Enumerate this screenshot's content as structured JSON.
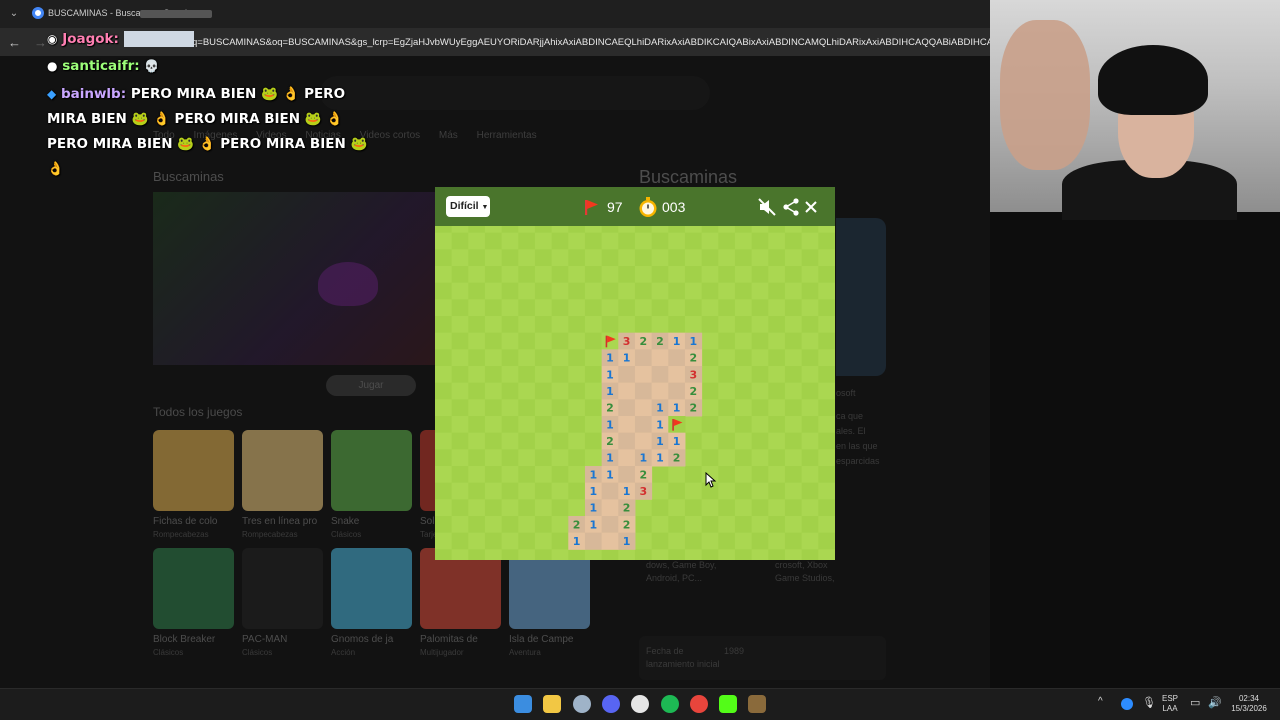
{
  "browser": {
    "tab_title": "BUSCAMINAS - Buscar con Google",
    "url": "q=BUSCAMINAS&oq=BUSCAMINAS&gs_lcrp=EgZjaHJvbWUyEggAEUYORiDARjjAhixAxiABDINCAEQLhiDARixAxiABDIKCAIQABixAxiABDINCAMQLhiDARixAxiABDIHCAQQABiABDIHCAUQABiABDIH"
  },
  "page": {
    "tabs": [
      "Todo",
      "Imágenes",
      "Videos",
      "Noticias",
      "Videos cortos",
      "Más",
      "Herramientas"
    ],
    "left_title": "Buscaminas",
    "play_label": "Jugar",
    "all_games_label": "Todos los juegos",
    "games_row1": [
      {
        "name": "Fichas de colo",
        "sub": "Rompecabezas",
        "color": "#e0b050"
      },
      {
        "name": "Tres en línea pro",
        "sub": "Rompecabezas",
        "color": "#e6c27a"
      },
      {
        "name": "Snake",
        "sub": "Clásicos",
        "color": "#5fb04a"
      },
      {
        "name": "Sol",
        "sub": "Tarje",
        "color": "#c0392b"
      }
    ],
    "games_row2": [
      {
        "name": "Block Breaker",
        "sub": "Clásicos",
        "color": "#2f7d4a"
      },
      {
        "name": "PAC-MAN",
        "sub": "Clásicos",
        "color": "#222222"
      },
      {
        "name": "Gnomos de ja",
        "sub": "Acción",
        "color": "#49b3d9"
      },
      {
        "name": "Palomitas de",
        "sub": "Multijugador",
        "color": "#d94a3a"
      },
      {
        "name": "Isla de Campe",
        "sub": "Aventura",
        "color": "#6fa7d8"
      }
    ],
    "right_title": "Buscaminas",
    "right_texts": [
      "osoft",
      "ca que",
      "ales. El",
      "en las que",
      "esparcidas",
      "dows, Game Boy,",
      "Android, PC...",
      "crosoft, Xbox",
      "Game Studios,",
      "Fecha de",
      "lanzamiento inicial",
      "1989"
    ]
  },
  "chat": [
    {
      "user": "Joagok:",
      "text": ""
    },
    {
      "user": "santicaifr:",
      "text": ""
    },
    {
      "user": "bainwlb:",
      "lines": [
        "PERO MIRA BIEN 🐸 👌 PERO",
        "MIRA BIEN 🐸 👌 PERO MIRA BIEN 🐸 👌",
        "PERO MIRA BIEN 🐸 👌 PERO MIRA BIEN 🐸",
        "👌"
      ]
    }
  ],
  "minesweeper": {
    "difficulty": "Difícil",
    "flags": "97",
    "timer": "003",
    "colors": {
      "header": "#4a752c",
      "light": "#aad751",
      "dark": "#a2d149",
      "rev_light": "#e5c29f",
      "rev_dark": "#d7b899"
    },
    "number_colors": {
      "1": "#1976d2",
      "2": "#388e3c",
      "3": "#d32f2f"
    },
    "grid_cols": 24,
    "grid_rows": 20,
    "revealed": [
      [
        11,
        7,
        "F"
      ],
      [
        12,
        7,
        "3"
      ],
      [
        13,
        7,
        "2"
      ],
      [
        14,
        7,
        "2"
      ],
      [
        15,
        7,
        "1"
      ],
      [
        16,
        7,
        "1"
      ],
      [
        11,
        8,
        "1"
      ],
      [
        12,
        8,
        "1"
      ],
      [
        13,
        8,
        ""
      ],
      [
        14,
        8,
        ""
      ],
      [
        15,
        8,
        ""
      ],
      [
        16,
        8,
        "2"
      ],
      [
        11,
        9,
        "1"
      ],
      [
        12,
        9,
        ""
      ],
      [
        13,
        9,
        ""
      ],
      [
        14,
        9,
        ""
      ],
      [
        15,
        9,
        ""
      ],
      [
        16,
        9,
        "3"
      ],
      [
        11,
        10,
        "1"
      ],
      [
        12,
        10,
        ""
      ],
      [
        13,
        10,
        ""
      ],
      [
        14,
        10,
        ""
      ],
      [
        15,
        10,
        ""
      ],
      [
        16,
        10,
        "2"
      ],
      [
        11,
        11,
        "2"
      ],
      [
        12,
        11,
        ""
      ],
      [
        13,
        11,
        ""
      ],
      [
        14,
        11,
        "1"
      ],
      [
        15,
        11,
        "1"
      ],
      [
        16,
        11,
        "2"
      ],
      [
        11,
        12,
        "1"
      ],
      [
        12,
        12,
        ""
      ],
      [
        13,
        12,
        ""
      ],
      [
        14,
        12,
        "1"
      ],
      [
        15,
        12,
        "F"
      ],
      [
        11,
        13,
        "2"
      ],
      [
        12,
        13,
        ""
      ],
      [
        13,
        13,
        ""
      ],
      [
        14,
        13,
        "1"
      ],
      [
        15,
        13,
        "1"
      ],
      [
        11,
        14,
        "1"
      ],
      [
        12,
        14,
        ""
      ],
      [
        13,
        14,
        "1"
      ],
      [
        14,
        14,
        "1"
      ],
      [
        15,
        14,
        "2"
      ],
      [
        10,
        15,
        "1"
      ],
      [
        11,
        15,
        "1"
      ],
      [
        12,
        15,
        ""
      ],
      [
        13,
        15,
        "2"
      ],
      [
        10,
        16,
        "1"
      ],
      [
        11,
        16,
        ""
      ],
      [
        12,
        16,
        "1"
      ],
      [
        13,
        16,
        "3"
      ],
      [
        10,
        17,
        "1"
      ],
      [
        11,
        17,
        ""
      ],
      [
        12,
        17,
        "2"
      ],
      [
        9,
        18,
        "2"
      ],
      [
        10,
        18,
        "1"
      ],
      [
        11,
        18,
        ""
      ],
      [
        12,
        18,
        "2"
      ],
      [
        9,
        19,
        "1"
      ],
      [
        10,
        19,
        ""
      ],
      [
        11,
        19,
        ""
      ],
      [
        12,
        19,
        "1"
      ]
    ]
  },
  "taskbar": {
    "apps": [
      {
        "name": "windows-start",
        "color": "#3b8de0"
      },
      {
        "name": "file-explorer",
        "color": "#f2c744"
      },
      {
        "name": "steam",
        "color": "#9fb3c8"
      },
      {
        "name": "discord",
        "color": "#5865f2"
      },
      {
        "name": "obs",
        "color": "#e6e6e6"
      },
      {
        "name": "spotify",
        "color": "#1db954"
      },
      {
        "name": "chrome",
        "color": "#e8453c"
      },
      {
        "name": "kick",
        "color": "#53fc18"
      },
      {
        "name": "minecraft",
        "color": "#8a6a3b"
      }
    ],
    "lang_top": "ESP",
    "lang_bottom": "LAA",
    "time": "02:34",
    "date": "15/3/2026"
  }
}
